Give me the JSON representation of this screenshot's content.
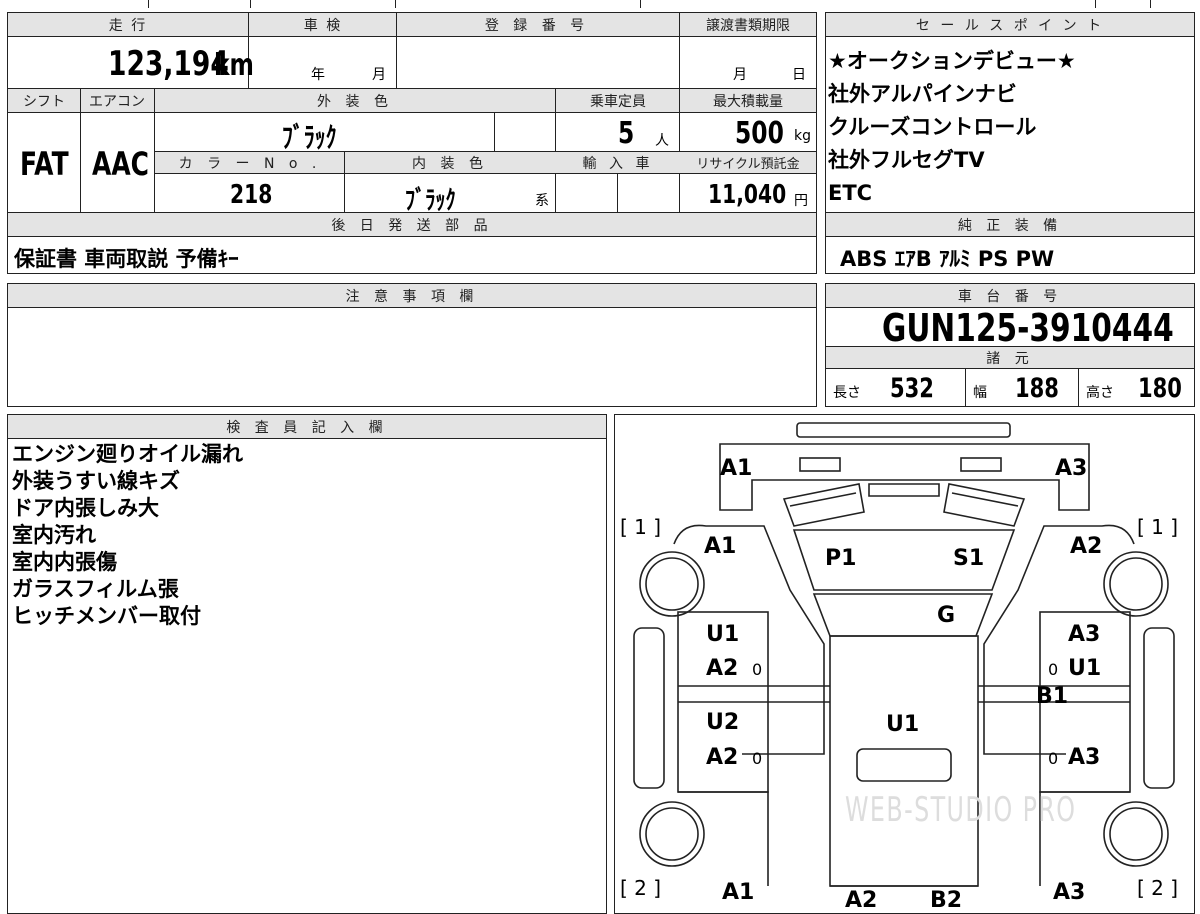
{
  "headers": {
    "mileage": "走 行",
    "inspection": "車 検",
    "registration": "登 録 番 号",
    "transfer_deadline": "譲渡書類期限",
    "sales_point": "セ ー ル ス ポ イ ン ト",
    "shift": "シフト",
    "aircon": "エアコン",
    "exterior_color": "外 装 色",
    "capacity": "乗車定員",
    "max_load": "最大積載量",
    "color_no": "カ ラ ー N o .",
    "interior_color": "内 装 色",
    "import": "輸 入 車",
    "recycle": "リサイクル預託金",
    "later_parts": "後 日 発 送 部 品",
    "genuine": "純 正 装 備",
    "notes": "注 意 事 項 欄",
    "chassis": "車 台 番 号",
    "specs": "諸 元",
    "inspector": "検 査 員 記 入 欄"
  },
  "vehicle": {
    "mileage_value": "123,194",
    "mileage_unit": "km",
    "inspection_year": "年",
    "inspection_month": "月",
    "transfer_month": "月",
    "transfer_day": "日",
    "shift": "FAT",
    "aircon": "AAC",
    "exterior_color": "ﾌﾞﾗｯｸ",
    "capacity": "5",
    "capacity_unit": "人",
    "max_load": "500",
    "max_load_unit": "kg",
    "color_no": "218",
    "interior_color": "ﾌﾞﾗｯｸ",
    "interior_suffix": "系",
    "recycle_fee": "11,040",
    "recycle_unit": "円",
    "later_parts": "保証書 車両取説 予備ｷｰ",
    "chassis_no": "GUN125-3910444",
    "length_label": "長さ",
    "length": "532",
    "width_label": "幅",
    "width": "188",
    "height_label": "高さ",
    "height": "180"
  },
  "sales_points": [
    "★オークションデビュー★",
    "社外アルパインナビ",
    "クルーズコントロール",
    "社外フルセグTV",
    "ETC"
  ],
  "genuine_equipment": "ABS ｴｱB ｱﾙﾐ PS PW",
  "inspector_notes": [
    "エンジン廻りオイル漏れ",
    "外装うすい線キズ",
    "ドア内張しみ大",
    "室内汚れ",
    "室内内張傷",
    "ガラスフィルム張",
    "ヒッチメンバー取付"
  ],
  "diagram": {
    "bracket_front_left": "[ 1 ]",
    "bracket_front_right": "[ 1 ]",
    "bracket_rear_left": "[ 2 ]",
    "bracket_rear_right": "[ 2 ]",
    "labels": {
      "front_left": "A1",
      "front_right": "A3",
      "fender_left": "A1",
      "fender_right": "A2",
      "hood_left": "P1",
      "hood_right": "S1",
      "windshield": "G",
      "door_fl_1": "U1",
      "door_fl_2": "A2",
      "door_fr_1": "A3",
      "door_fr_2": "U1",
      "pillar_right": "B1",
      "door_rl_1": "U2",
      "door_rl_2": "A2",
      "roof": "U1",
      "door_rr": "A3",
      "rear_left": "A1",
      "rear_center_1": "A2",
      "rear_center_2": "B2",
      "rear_right": "A3",
      "zero": "0"
    },
    "watermark": "WEB-STUDIO PRO"
  }
}
